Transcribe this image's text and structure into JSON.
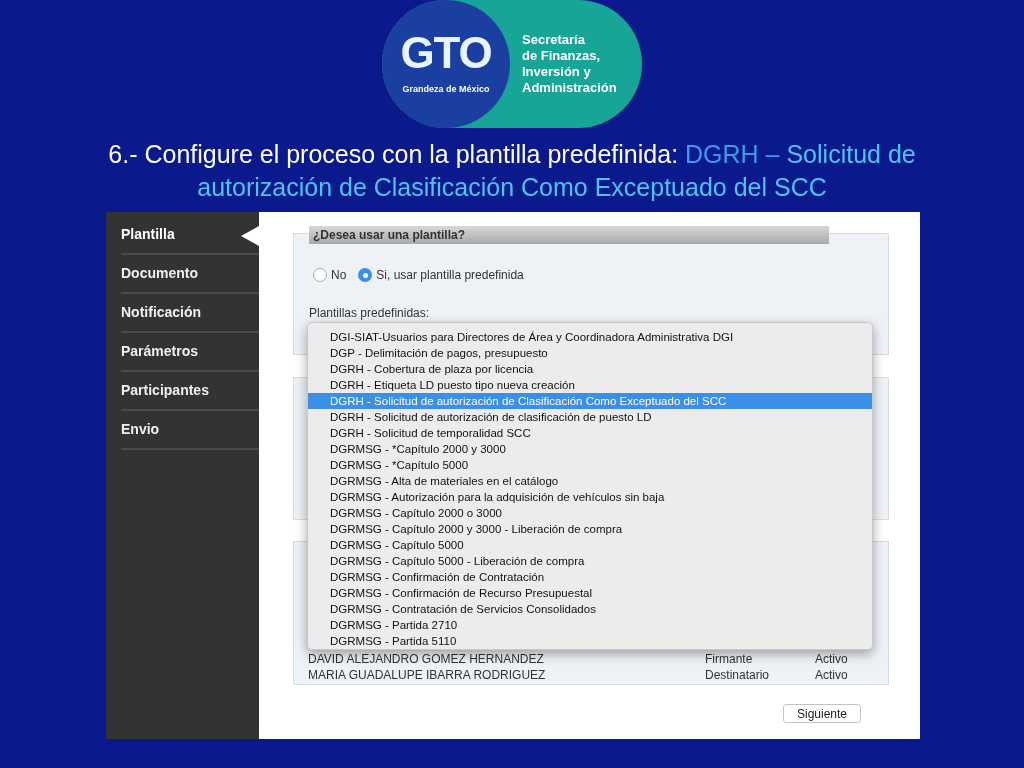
{
  "logo": {
    "mark": "GTO",
    "tagline": "Grandeza de México",
    "org_lines": [
      "Secretaría",
      "de Finanzas,",
      "Inversión y",
      "Administración"
    ]
  },
  "title": {
    "prefix": "6.- Configure el proceso con la plantilla predefinida: ",
    "highlight_lead": "DGRH –",
    "highlight_rest": " Solicitud de autorización de Clasificación Como Exceptuado del SCC"
  },
  "sidebar": {
    "items": [
      {
        "label": "Plantilla",
        "selected": true
      },
      {
        "label": "Documento",
        "selected": false
      },
      {
        "label": "Notificación",
        "selected": false
      },
      {
        "label": "Parámetros",
        "selected": false
      },
      {
        "label": "Participantes",
        "selected": false
      },
      {
        "label": "Envio",
        "selected": false
      }
    ]
  },
  "template_panel": {
    "header": "¿Desea usar una plantilla?",
    "options": [
      {
        "label": "No",
        "selected": false
      },
      {
        "label": "Si, usar plantilla predefinida",
        "selected": true
      }
    ],
    "select_label": "Plantillas predefinidas:"
  },
  "dropdown": {
    "items": [
      {
        "label": "DGI-SIAT-Usuarios para Directores de Área y Coordinadora Administrativa DGI",
        "selected": false
      },
      {
        "label": "DGP - Delimitación de pagos, presupuesto",
        "selected": false
      },
      {
        "label": "DGRH - Cobertura de plaza por licencia",
        "selected": false
      },
      {
        "label": "DGRH - Etiqueta LD puesto tipo nueva creación",
        "selected": false
      },
      {
        "label": "DGRH - Solicitud de autorización de Clasificación Como Exceptuado del SCC",
        "selected": true
      },
      {
        "label": "DGRH - Solicitud de autorización de clasificación de puesto LD",
        "selected": false
      },
      {
        "label": "DGRH - Solicitud de temporalidad SCC",
        "selected": false
      },
      {
        "label": "DGRMSG - *Capítulo 2000 y 3000",
        "selected": false
      },
      {
        "label": "DGRMSG - *Capítulo 5000",
        "selected": false
      },
      {
        "label": "DGRMSG - Alta de materiales en el catálogo",
        "selected": false
      },
      {
        "label": "DGRMSG - Autorización para la adquisición de vehículos sin baja",
        "selected": false
      },
      {
        "label": "DGRMSG - Capítulo 2000 o 3000",
        "selected": false
      },
      {
        "label": "DGRMSG - Capítulo 2000 y 3000 - Liberación de compra",
        "selected": false
      },
      {
        "label": "DGRMSG - Capítulo 5000",
        "selected": false
      },
      {
        "label": "DGRMSG - Capítulo 5000 - Liberación de compra",
        "selected": false
      },
      {
        "label": "DGRMSG - Confirmación de Contratación",
        "selected": false
      },
      {
        "label": "DGRMSG - Confirmación de Recurso Presupuestal",
        "selected": false
      },
      {
        "label": "DGRMSG - Contratación de Servicios Consolidados",
        "selected": false
      },
      {
        "label": "DGRMSG - Partida 2710",
        "selected": false
      },
      {
        "label": "DGRMSG - Partida 5110",
        "selected": false
      }
    ]
  },
  "participants": {
    "rows": [
      [
        "DAVID ALEJANDRO GOMEZ HERNANDEZ",
        "Firmante",
        "Activo"
      ],
      [
        "MARIA GUADALUPE IBARRA RODRIGUEZ",
        "Destinatario",
        "Activo"
      ]
    ]
  },
  "next_button": "Siguiente"
}
